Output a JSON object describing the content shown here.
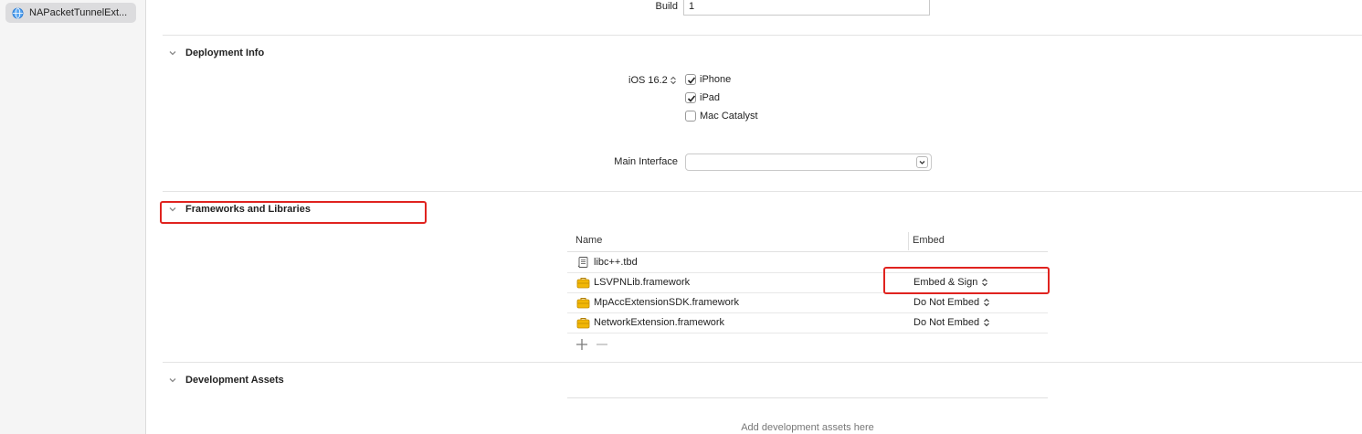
{
  "sidebar": {
    "selected_target": "NAPacketTunnelExt..."
  },
  "identity": {
    "build_label": "Build",
    "build_value": "1"
  },
  "deployment": {
    "title": "Deployment Info",
    "os_version": "iOS 16.2",
    "devices": [
      {
        "label": "iPhone",
        "checked": true
      },
      {
        "label": "iPad",
        "checked": true
      },
      {
        "label": "Mac Catalyst",
        "checked": false
      }
    ],
    "main_interface_label": "Main Interface",
    "main_interface_value": ""
  },
  "frameworks": {
    "title": "Frameworks and Libraries",
    "columns": {
      "name": "Name",
      "embed": "Embed"
    },
    "items": [
      {
        "name": "libc++.tbd",
        "icon": "library-file-icon",
        "embed": ""
      },
      {
        "name": "LSVPNLib.framework",
        "icon": "framework-toolbox-icon",
        "embed": "Embed & Sign"
      },
      {
        "name": "MpAccExtensionSDK.framework",
        "icon": "framework-toolbox-icon",
        "embed": "Do Not Embed"
      },
      {
        "name": "NetworkExtension.framework",
        "icon": "framework-toolbox-icon",
        "embed": "Do Not Embed"
      }
    ]
  },
  "development_assets": {
    "title": "Development Assets",
    "empty_text": "Add development assets here"
  },
  "colors": {
    "highlight": "#e0231f",
    "framework_icon": "#f2b705"
  }
}
